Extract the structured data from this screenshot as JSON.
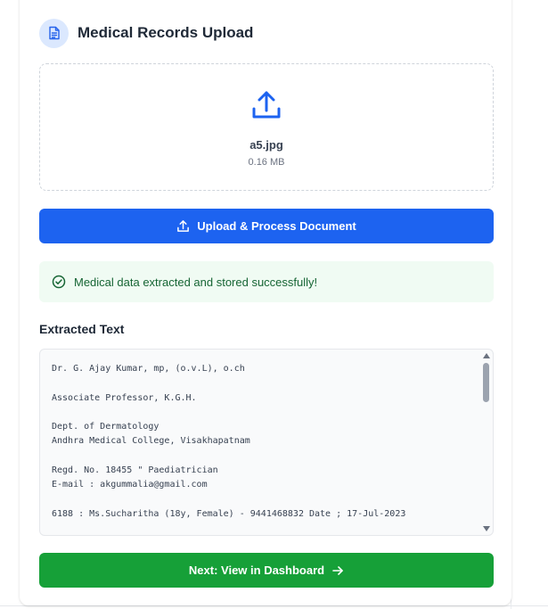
{
  "header": {
    "title": "Medical Records Upload",
    "icon": "document-icon"
  },
  "dropzone": {
    "icon": "upload-icon",
    "file_name": "a5.jpg",
    "file_size": "0.16 MB"
  },
  "upload_button": {
    "label": "Upload & Process Document",
    "icon": "upload-icon",
    "color": "#1d63f0"
  },
  "alert": {
    "message": "Medical data extracted and stored successfully!",
    "icon": "check-circle-icon",
    "color": "#166534"
  },
  "extracted": {
    "title": "Extracted Text",
    "lines": [
      "Dr. G. Ajay Kumar, mp, (o.v.L), o.ch",
      "",
      "Associate Professor, K.G.H.",
      "",
      "Dept. of Dermatology",
      "Andhra Medical College, Visakhapatnam",
      "",
      "Regd. No. 18455 \" Paediatrician",
      "E-mail : akgummalia@gmail.com",
      "",
      "6188 : Ms.Sucharitha (18y, Female) - 9441468832 Date ; 17-Jul-2023"
    ]
  },
  "next_button": {
    "label": "Next: View in Dashboard",
    "icon": "arrow-right-icon",
    "color": "#16a038"
  }
}
